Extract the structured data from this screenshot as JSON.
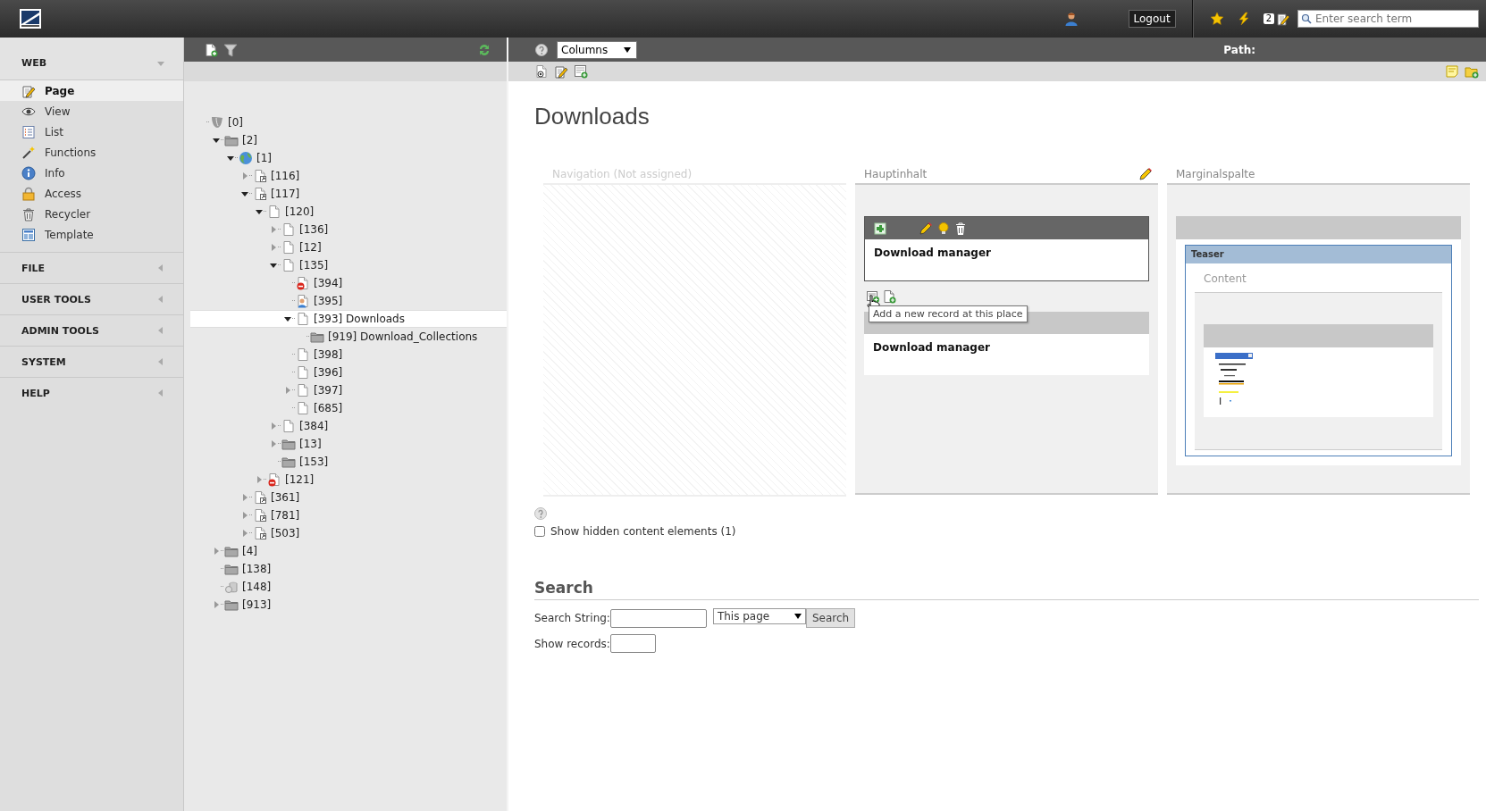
{
  "topbar": {
    "logout": "Logout",
    "bookmark_count": "2",
    "search": {
      "placeholder": "Enter search term"
    }
  },
  "module_menu": [
    {
      "label": "WEB",
      "expanded": true,
      "items": [
        {
          "label": "Page",
          "kind": "page-edit",
          "selected": true
        },
        {
          "label": "View",
          "kind": "eye",
          "selected": false
        },
        {
          "label": "List",
          "kind": "list",
          "selected": false
        },
        {
          "label": "Functions",
          "kind": "wand",
          "selected": false
        },
        {
          "label": "Info",
          "kind": "info",
          "selected": false
        },
        {
          "label": "Access",
          "kind": "lock",
          "selected": false
        },
        {
          "label": "Recycler",
          "kind": "trash",
          "selected": false
        },
        {
          "label": "Template",
          "kind": "template",
          "selected": false
        }
      ]
    },
    {
      "label": "FILE",
      "expanded": false
    },
    {
      "label": "USER TOOLS",
      "expanded": false
    },
    {
      "label": "ADMIN TOOLS",
      "expanded": false
    },
    {
      "label": "SYSTEM",
      "expanded": false
    },
    {
      "label": "HELP",
      "expanded": false
    }
  ],
  "page_tree": {
    "nodes": [
      {
        "label": "[0]",
        "kind": "root",
        "selected": false,
        "children": [
          {
            "label": "[2]",
            "kind": "folder",
            "expanded": true,
            "selected": false,
            "children": [
              {
                "label": "[1]",
                "kind": "globe",
                "expanded": true,
                "selected": false,
                "children": [
                  {
                    "label": "[116]",
                    "kind": "shortcut",
                    "expanded": false,
                    "selected": false
                  },
                  {
                    "label": "[117]",
                    "kind": "shortcut",
                    "expanded": true,
                    "selected": false,
                    "children": [
                      {
                        "label": "[120]",
                        "kind": "page",
                        "expanded": true,
                        "selected": false,
                        "children": [
                          {
                            "label": "[136]",
                            "kind": "page",
                            "expanded": false,
                            "selected": false
                          },
                          {
                            "label": "[12]",
                            "kind": "page",
                            "expanded": false,
                            "selected": false
                          },
                          {
                            "label": "[135]",
                            "kind": "page",
                            "expanded": true,
                            "selected": false,
                            "children": [
                              {
                                "label": "[394]",
                                "kind": "page-hidden",
                                "selected": false
                              },
                              {
                                "label": "[395]",
                                "kind": "page-user",
                                "selected": false
                              },
                              {
                                "label": "[393] Downloads",
                                "kind": "page",
                                "expanded": true,
                                "selected": true,
                                "children": [
                                  {
                                    "label": "[919] Download_Collections",
                                    "kind": "folder",
                                    "selected": false
                                  }
                                ]
                              },
                              {
                                "label": "[398]",
                                "kind": "page",
                                "selected": false
                              },
                              {
                                "label": "[396]",
                                "kind": "page",
                                "selected": false
                              },
                              {
                                "label": "[397]",
                                "kind": "page",
                                "expanded": false,
                                "selected": false
                              },
                              {
                                "label": "[685]",
                                "kind": "page",
                                "selected": false
                              }
                            ]
                          },
                          {
                            "label": "[384]",
                            "kind": "page",
                            "expanded": false,
                            "selected": false
                          },
                          {
                            "label": "[13]",
                            "kind": "folder",
                            "expanded": false,
                            "selected": false
                          },
                          {
                            "label": "[153]",
                            "kind": "folder",
                            "selected": false
                          }
                        ]
                      },
                      {
                        "label": "[121]",
                        "kind": "page-hidden",
                        "expanded": false,
                        "selected": false
                      }
                    ]
                  },
                  {
                    "label": "[361]",
                    "kind": "shortcut",
                    "expanded": false,
                    "selected": false
                  },
                  {
                    "label": "[781]",
                    "kind": "shortcut",
                    "expanded": false,
                    "selected": false
                  },
                  {
                    "label": "[503]",
                    "kind": "shortcut",
                    "expanded": false,
                    "selected": false
                  }
                ]
              }
            ]
          },
          {
            "label": "[4]",
            "kind": "folder",
            "expanded": false,
            "selected": false
          },
          {
            "label": "[138]",
            "kind": "folder",
            "selected": false
          },
          {
            "label": "[148]",
            "kind": "recycler",
            "selected": false
          },
          {
            "label": "[913]",
            "kind": "folder",
            "expanded": false,
            "selected": false
          }
        ]
      }
    ]
  },
  "docheader": {
    "view_select": "Columns",
    "path_label": "Path:"
  },
  "page_title": "Downloads",
  "columns": [
    {
      "title": "Navigation (Not assigned)",
      "kind": "unassigned",
      "editable": false
    },
    {
      "title": "Hauptinhalt",
      "kind": "content",
      "editable": true,
      "new_record_tooltip": "Add a new record at this place",
      "elements": [
        {
          "kind": "text",
          "title": "Download manager",
          "highlighted": true
        },
        {
          "kind": "text",
          "title": "Download manager",
          "highlighted": false
        }
      ]
    },
    {
      "title": "Marginalspalte",
      "kind": "content",
      "editable": false,
      "elements": [
        {
          "kind": "grid",
          "header": "Teaser",
          "sub_column": "Content"
        }
      ]
    }
  ],
  "show_hidden": {
    "label": "Show hidden content elements (1)",
    "checked": false
  },
  "search": {
    "heading": "Search",
    "string_label": "Search String:",
    "scope": "This page",
    "button": "Search",
    "records_label": "Show records:"
  }
}
